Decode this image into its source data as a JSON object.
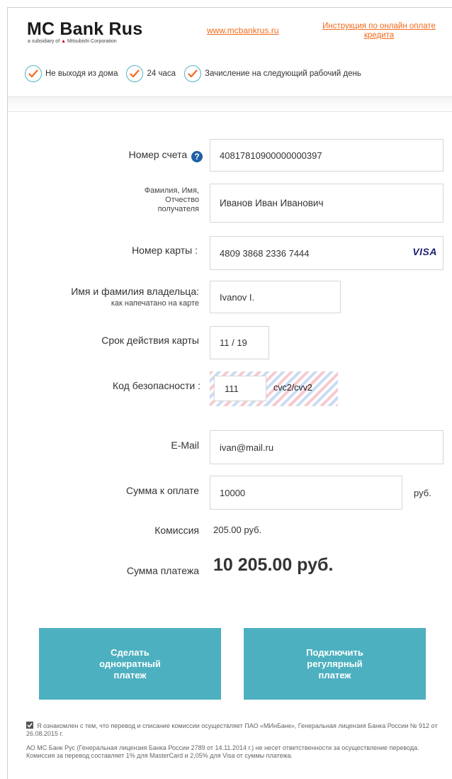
{
  "header": {
    "logo_title": "MC Bank Rus",
    "logo_subtitle_pre": "a subsidiary of",
    "logo_subtitle_brand": "Mitsubishi Corporation",
    "site_link": "www.mcbankrus.ru",
    "instruction_link": "Инструкция по онлайн оплате кредита",
    "features": [
      "Не выходя из дома",
      "24 часа",
      "Зачисление на следующий рабочий день"
    ]
  },
  "form": {
    "account": {
      "label": "Номер счета",
      "help": "?",
      "value": "40817810900000000397"
    },
    "recipient": {
      "label_lines": [
        "Фамилия, Имя,",
        "Отчество",
        "получателя"
      ],
      "value": "Иванов Иван Иванович"
    },
    "card_number": {
      "label": "Номер карты :",
      "value": "4809 3868 2336 7444",
      "brand": "VISA"
    },
    "holder": {
      "label": "Имя и фамилия владельца:",
      "hint": "как напечатано на карте",
      "value": "Ivanov I."
    },
    "expiry": {
      "label": "Срок действия карты",
      "value": "11 / 19"
    },
    "cvc": {
      "label": "Код безопасности :",
      "value": "111",
      "hint": "cvc2/cvv2"
    },
    "email": {
      "label": "E-Mail",
      "value": "ivan@mail.ru"
    },
    "amount": {
      "label": "Сумма к оплате",
      "value": "10000",
      "currency": "руб."
    },
    "commission": {
      "label": "Комиссия",
      "value": "205.00 руб."
    },
    "total": {
      "label": "Сумма платежа",
      "value": "10 205.00 руб."
    }
  },
  "buttons": {
    "one_time": [
      "Сделать",
      "однократный",
      "платеж"
    ],
    "recurring": [
      "Подключить",
      "регулярный",
      "платеж"
    ]
  },
  "footer": {
    "agreement": "Я ознакомлен с тем, что перевод и списание комиссии осуществляет ПАО «МИнБанк», Генеральная лицензия Банка России № 912 от 26.08.2015 г.",
    "disclaimer": "АО МС Банк Рус (Генеральная лицензия Банка России 2789 от 14.11.2014 г.) не несет ответственности за осуществление перевода. Комиссия за перевод составляет 1% для MasterCard и 2,05% для Visa от суммы платежа."
  },
  "colors": {
    "accent": "#4db0c0",
    "link": "#f26a1b",
    "help": "#1f5fa6",
    "visa": "#1a1f71"
  }
}
